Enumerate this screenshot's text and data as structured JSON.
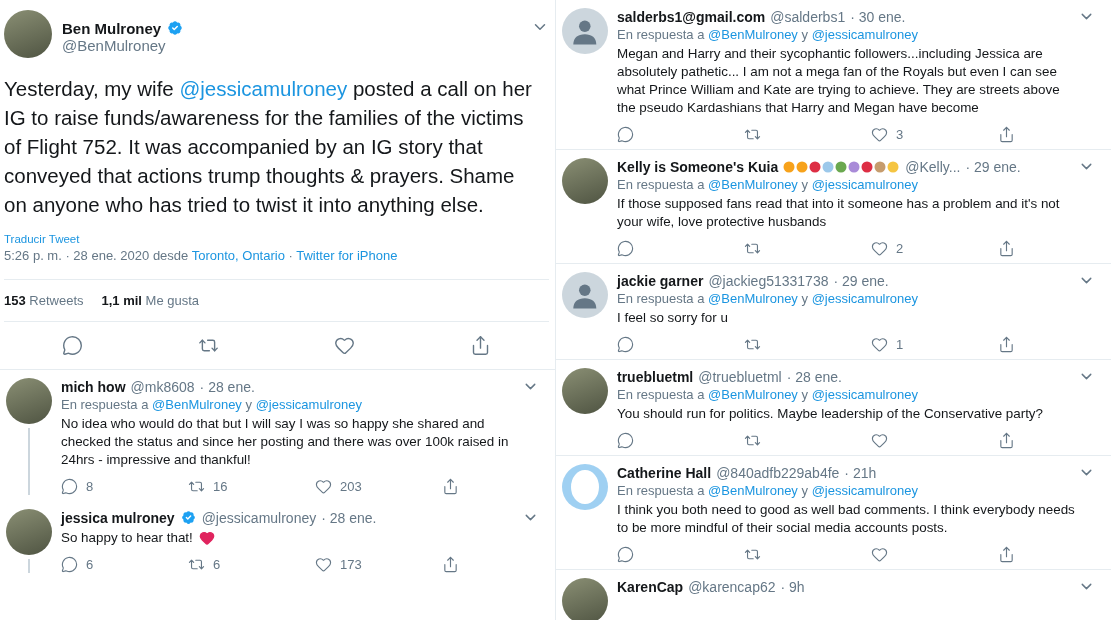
{
  "main_tweet": {
    "name": "Ben Mulroney",
    "verified": true,
    "handle": "@BenMulroney",
    "avatar": {
      "kind": "photo"
    },
    "text": [
      {
        "kind": "plain",
        "text": "Yesterday, my wife "
      },
      {
        "kind": "link",
        "text": "@jessicamulroney"
      },
      {
        "kind": "plain",
        "text": " posted a call on her IG to raise funds/awareness for the families of the victims of Flight 752. It was accompanied by an IG story that conveyed that actions trump thoughts & prayers. Shame on anyone who has tried to twist it into anything else."
      }
    ],
    "translate": "Traducir Tweet",
    "meta": [
      {
        "kind": "plain",
        "text": "5:26 p. m. · 28 ene. 2020 desde "
      },
      {
        "kind": "link",
        "text": "Toronto, Ontario"
      },
      {
        "kind": "plain",
        "text": " · "
      },
      {
        "kind": "link",
        "text": "Twitter for iPhone"
      }
    ],
    "stats": [
      "**153** Retweets",
      "**1,1 mil** Me gusta"
    ]
  },
  "columns": [
    {
      "replies": [
        {
          "name": "mich how",
          "handle": "@mk8608",
          "date": "· 28 ene.",
          "avatar": {
            "kind": "photo"
          },
          "thread": true,
          "reply_to": [
            "En respuesta a",
            "@BenMulroney",
            "y",
            "@jessicamulroney"
          ],
          "text": "No idea who would do that but I will say I was so happy she shared and checked the status and since her posting and there was over 100k raised in 24hrs - impressive and thankful!",
          "counts": {
            "reply": "8",
            "retweet": "16",
            "like": "203"
          }
        },
        {
          "name": "jessica mulroney",
          "verified": true,
          "handle": "@jessicamulroney",
          "date": "· 28 ene.",
          "avatar": {
            "kind": "photo"
          },
          "thread": true,
          "text": "So happy to hear that!",
          "heart_emoji": true,
          "counts": {
            "reply": "6",
            "retweet": "6",
            "like": "173"
          }
        }
      ]
    },
    {
      "replies": [
        {
          "name": "salderbs1@gmail.com",
          "handle": "@salderbs1",
          "date": "· 30 ene.",
          "avatar": {
            "kind": "default"
          },
          "reply_to": [
            "En respuesta a",
            "@BenMulroney",
            "y",
            "@jessicamulroney"
          ],
          "text": "Megan and Harry and their sycophantic followers...including Jessica are absolutely pathetic... I am not a mega fan of the Royals but even I can see what Prince William and Kate are trying to achieve. They are streets above the pseudo Kardashians that Harry and Megan have become",
          "counts": {
            "like": "3"
          }
        },
        {
          "name": "Kelly is Someone's Kuia",
          "name_emojis": true,
          "handle": "@Kelly...",
          "date": "· 29 ene.",
          "avatar": {
            "kind": "photo"
          },
          "reply_to": [
            "En respuesta a",
            "@BenMulroney",
            "y",
            "@jessicamulroney"
          ],
          "text": "If those supposed fans read that into it someone has a problem and it's not your wife, love protective husbands",
          "counts": {
            "like": "2"
          }
        },
        {
          "name": "jackie garner",
          "handle": "@jackieg51331738",
          "date": "· 29 ene.",
          "avatar": {
            "kind": "default"
          },
          "reply_to": [
            "En respuesta a",
            "@BenMulroney",
            "y",
            "@jessicamulroney"
          ],
          "text": "I feel so sorry for u",
          "counts": {
            "like": "1"
          }
        },
        {
          "name": "truebluetml",
          "handle": "@truebluetml",
          "date": "· 28 ene.",
          "avatar": {
            "kind": "photo"
          },
          "reply_to": [
            "En respuesta a",
            "@BenMulroney",
            "y",
            "@jessicamulroney"
          ],
          "text": "You should run for politics. Maybe leadership of the Conservative party?"
        },
        {
          "name": "Catherine Hall",
          "handle": "@840adfb229ab4fe",
          "date": "· 21h",
          "avatar": {
            "kind": "egg"
          },
          "reply_to": [
            "En respuesta a",
            "@BenMulroney",
            "y",
            "@jessicamulroney"
          ],
          "text": "I think you both need to good as well bad comments. I think everybody needs to be more mindful of their social media accounts posts."
        },
        {
          "name": "KarenCap",
          "handle": "@karencap62",
          "date": "· 9h",
          "avatar": {
            "kind": "photo"
          }
        }
      ]
    }
  ]
}
